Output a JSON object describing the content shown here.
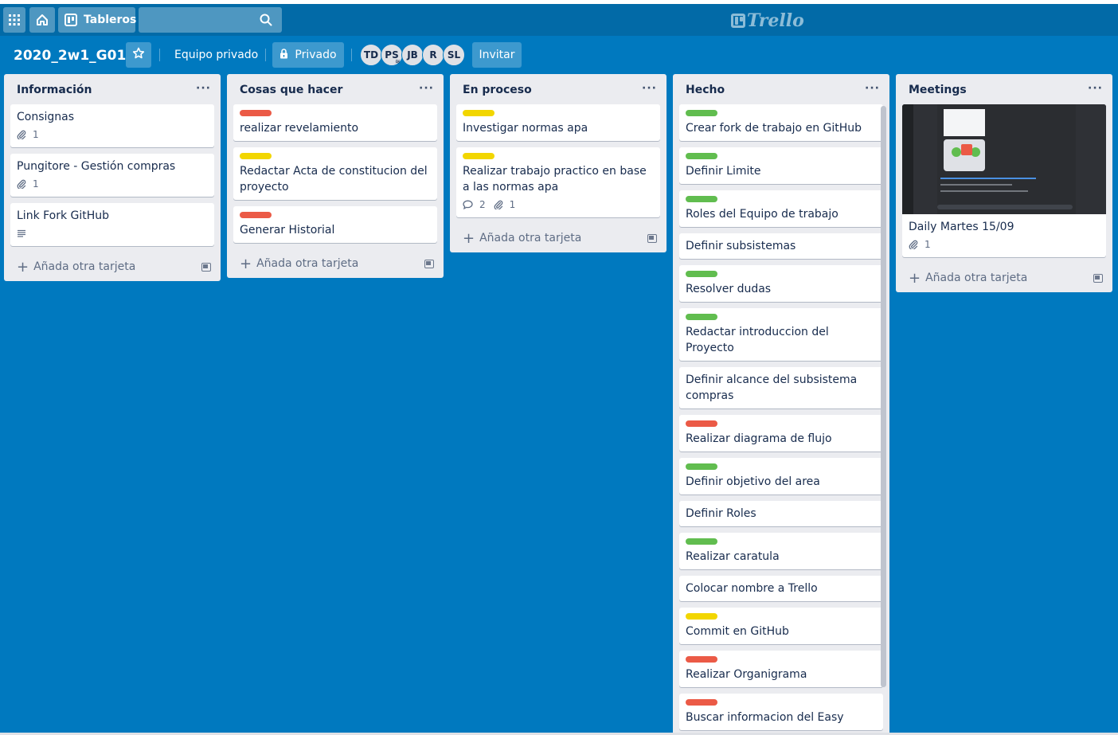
{
  "header": {
    "boards_label": "Tableros",
    "logo_text": "Trello"
  },
  "board": {
    "title": "2020_2w1_G01",
    "team": "Equipo privado",
    "visibility": "Privado",
    "invite": "Invitar",
    "members": [
      "TD",
      "PS",
      "JB",
      "R",
      "SL"
    ]
  },
  "colors": {
    "background": "#0079bf",
    "header": "#026aa7",
    "label_red": "#eb5a46",
    "label_yellow": "#f2d600",
    "label_green": "#61bd4f"
  },
  "add_card_label": "Añada otra tarjeta",
  "lists": [
    {
      "name": "Información",
      "cards": [
        {
          "title": "Consignas",
          "attachments": "1"
        },
        {
          "title": "Pungitore - Gestión compras",
          "attachments": "1"
        },
        {
          "title": "Link Fork GitHub",
          "description": true
        }
      ]
    },
    {
      "name": "Cosas que hacer",
      "cards": [
        {
          "title": "realizar revelamiento",
          "label": "red"
        },
        {
          "title": "Redactar Acta de constitucion del proyecto",
          "label": "yellow"
        },
        {
          "title": "Generar Historial",
          "label": "red"
        }
      ]
    },
    {
      "name": "En proceso",
      "cards": [
        {
          "title": "Investigar normas apa",
          "label": "yellow"
        },
        {
          "title": "Realizar trabajo practico en base a las normas apa",
          "label": "yellow",
          "comments": "2",
          "attachments": "1"
        }
      ]
    },
    {
      "name": "Hecho",
      "cards": [
        {
          "title": "Crear fork de trabajo en GitHub",
          "label": "green"
        },
        {
          "title": "Definir Limite",
          "label": "green"
        },
        {
          "title": "Roles del Equipo de trabajo",
          "label": "green"
        },
        {
          "title": "Definir subsistemas"
        },
        {
          "title": "Resolver dudas",
          "label": "green"
        },
        {
          "title": "Redactar introduccion del Proyecto",
          "label": "green"
        },
        {
          "title": "Definir alcance del subsistema compras"
        },
        {
          "title": "Realizar diagrama de flujo",
          "label": "red"
        },
        {
          "title": "Definir objetivo del area",
          "label": "green"
        },
        {
          "title": "Definir Roles"
        },
        {
          "title": "Realizar caratula",
          "label": "green"
        },
        {
          "title": "Colocar nombre a Trello"
        },
        {
          "title": "Commit en GitHub",
          "label": "yellow"
        },
        {
          "title": "Realizar Organigrama",
          "label": "red"
        },
        {
          "title": "Buscar informacion del Easy",
          "label": "red"
        }
      ]
    },
    {
      "name": "Meetings",
      "cards": [
        {
          "title": "Daily Martes 15/09",
          "attachments": "1",
          "cover": true
        }
      ]
    }
  ]
}
